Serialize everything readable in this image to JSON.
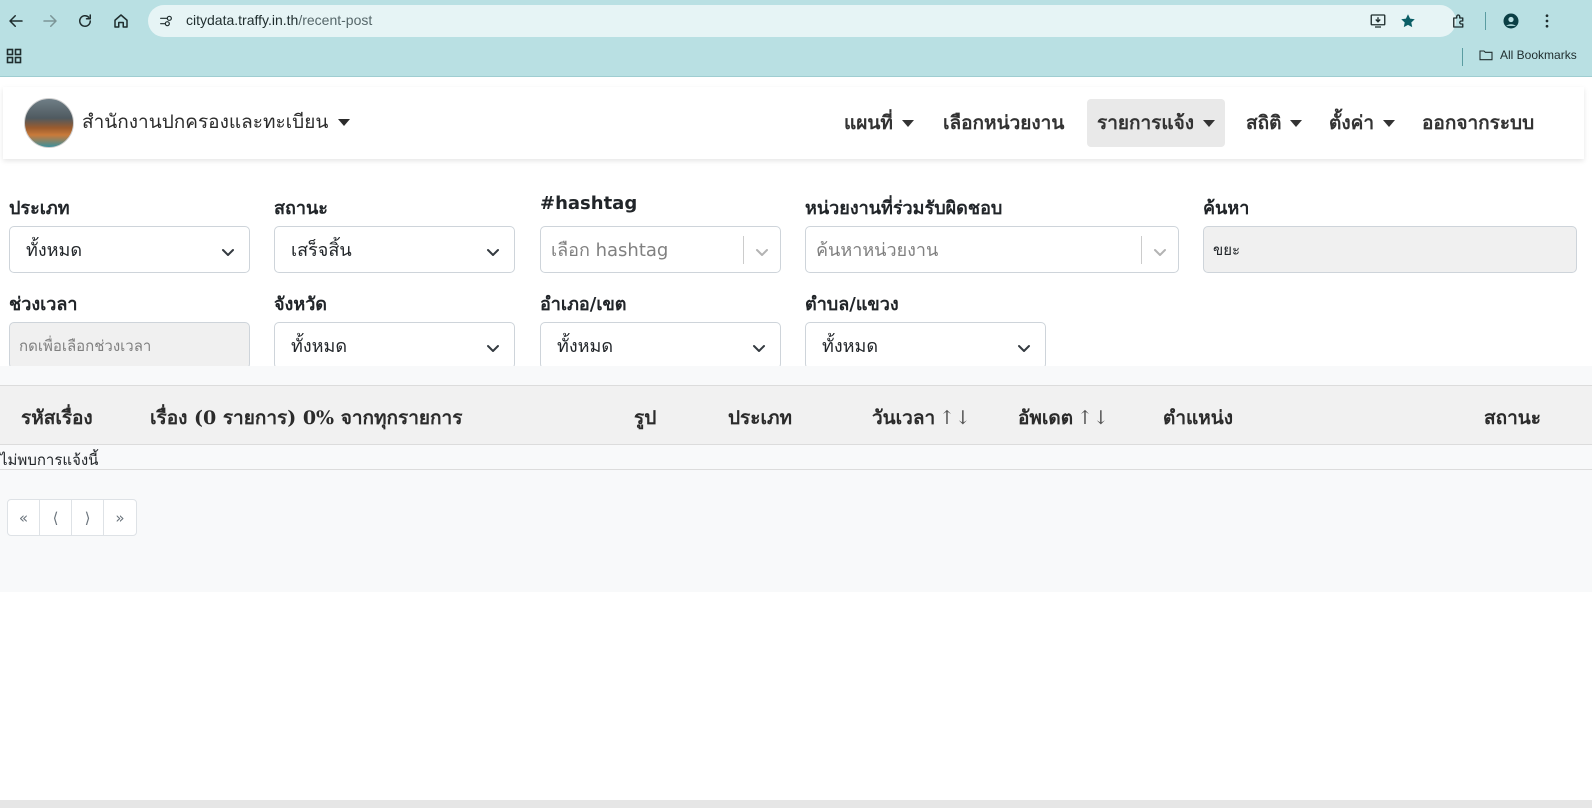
{
  "browser": {
    "url_host": "citydata.traffy.in.th",
    "url_path": "/recent-post",
    "bookmarks_label": "All Bookmarks",
    "icons": [
      "back-icon",
      "forward-icon",
      "reload-icon",
      "home-icon",
      "site-info-icon",
      "install-icon",
      "star-icon",
      "extensions-icon",
      "profile-icon",
      "kebab-menu-icon",
      "apps-grid-icon",
      "folder-icon"
    ]
  },
  "navbar": {
    "org_name": "สำนักงานปกครองและทะเบียน",
    "menus": [
      {
        "label": "แผนที่",
        "dropdown": true
      },
      {
        "label": "เลือกหน่วยงาน",
        "dropdown": false
      },
      {
        "label": "รายการแจ้ง",
        "dropdown": true,
        "active": true
      },
      {
        "label": "สถิติ",
        "dropdown": true
      },
      {
        "label": "ตั้งค่า",
        "dropdown": true
      },
      {
        "label": "ออกจากระบบ",
        "dropdown": false
      }
    ]
  },
  "filters": {
    "type": {
      "label": "ประเภท",
      "value": "ทั้งหมด"
    },
    "status": {
      "label": "สถานะ",
      "value": "เสร็จสิ้น"
    },
    "hashtag": {
      "label": "#hashtag",
      "placeholder": "เลือก hashtag"
    },
    "agency": {
      "label": "หน่วยงานที่ร่วมรับผิดชอบ",
      "placeholder": "ค้นหาหน่วยงาน"
    },
    "search": {
      "label": "ค้นหา",
      "value": "ขยะ"
    },
    "period": {
      "label": "ช่วงเวลา",
      "placeholder": "กดเพื่อเลือกช่วงเวลา"
    },
    "province": {
      "label": "จังหวัด",
      "value": "ทั้งหมด"
    },
    "district": {
      "label": "อำเภอ/เขต",
      "value": "ทั้งหมด"
    },
    "subdistrict": {
      "label": "ตำบล/แขวง",
      "value": "ทั้งหมด"
    }
  },
  "table": {
    "columns": {
      "id": "รหัสเรื่อง",
      "title": "เรื่อง (0 รายการ) 0% จากทุกรายการ",
      "image": "รูป",
      "type": "ประเภท",
      "datetime": "วันเวลา",
      "updated": "อัพเดต",
      "location": "ตำแหน่ง",
      "status": "สถานะ"
    },
    "sort_arrows": "↑↓",
    "empty_message": "ไม่พบการแจ้งนี้"
  },
  "pagination": {
    "first": "«",
    "prev": "⟨",
    "next": "⟩",
    "last": "»"
  }
}
